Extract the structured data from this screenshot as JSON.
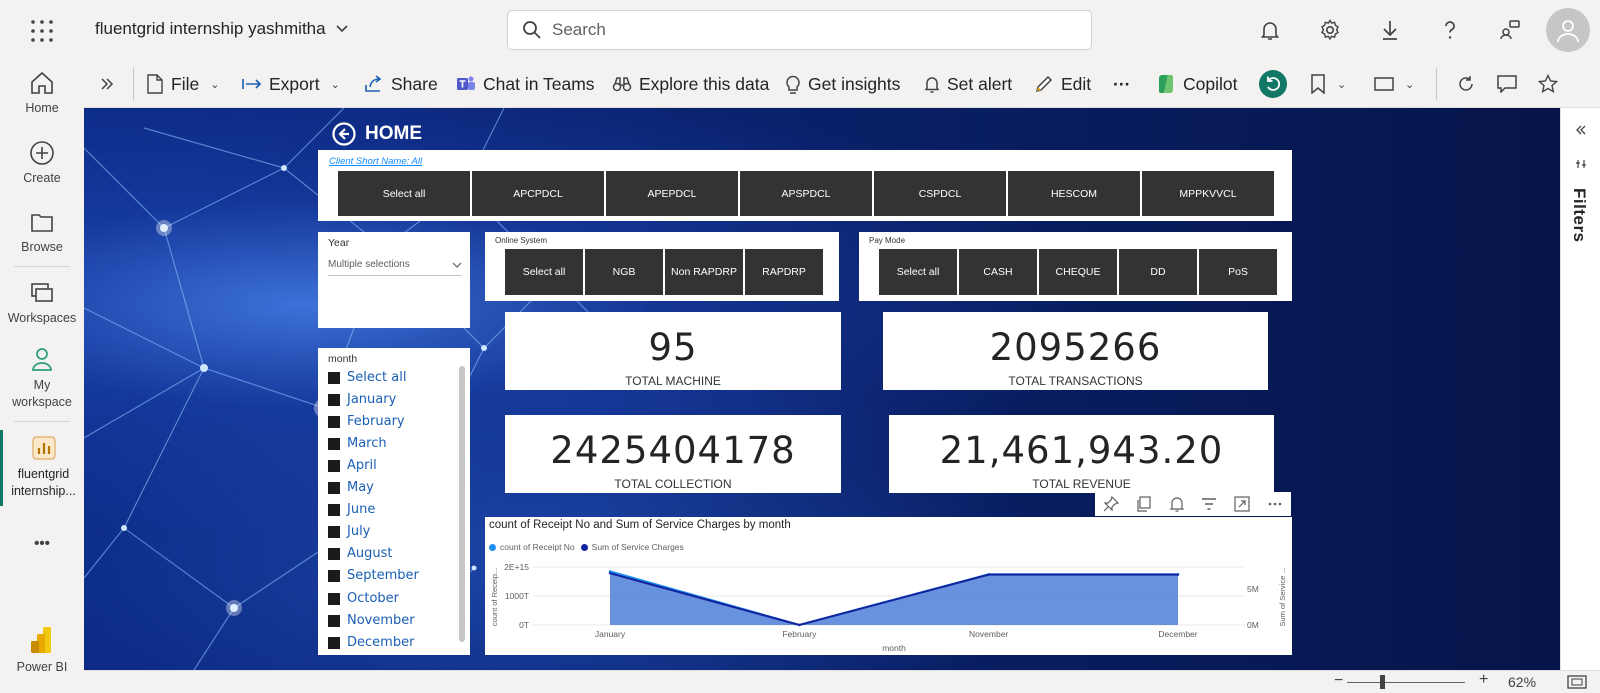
{
  "app": {
    "workspace_title": "fluentgrid internship yashmitha",
    "search_placeholder": "Search",
    "brand_label": "Power BI"
  },
  "left_nav": {
    "home": "Home",
    "create": "Create",
    "browse": "Browse",
    "workspaces": "Workspaces",
    "my_workspace": "My workspace",
    "report": "fluentgrid internship...",
    "more": "•••"
  },
  "ribbon": {
    "file": "File",
    "export": "Export",
    "share": "Share",
    "chat_in_teams": "Chat in Teams",
    "explore": "Explore this data",
    "insights": "Get insights",
    "set_alert": "Set alert",
    "edit": "Edit",
    "more": "···",
    "copilot": "Copilot"
  },
  "filters_pane": {
    "label": "Filters"
  },
  "status": {
    "zoom": "62%",
    "zoom_level": 0.62
  },
  "report": {
    "home_label": "HOME",
    "client_label": "Client Short Name: All",
    "clients": [
      "Select all",
      "APCPDCL",
      "APEPDCL",
      "APSPDCL",
      "CSPDCL",
      "HESCOM",
      "MPPKVVCL"
    ],
    "year": {
      "title": "Year",
      "value": "Multiple selections"
    },
    "online_system": {
      "title": "Online System",
      "options": [
        "Select all",
        "NGB",
        "Non RAPDRP",
        "RAPDRP"
      ]
    },
    "pay_mode": {
      "title": "Pay Mode",
      "options": [
        "Select all",
        "CASH",
        "CHEQUE",
        "DD",
        "PoS"
      ]
    },
    "month": {
      "title": "month",
      "options": [
        "Select all",
        "January",
        "February",
        "March",
        "April",
        "May",
        "June",
        "July",
        "August",
        "September",
        "October",
        "November",
        "December"
      ]
    },
    "kpis": {
      "total_machine": {
        "value": "95",
        "label": "TOTAL MACHINE"
      },
      "total_transactions": {
        "value": "2095266",
        "label": "TOTAL TRANSACTIONS"
      },
      "total_collection": {
        "value": "2425404178",
        "label": "TOTAL COLLECTION"
      },
      "total_revenue": {
        "value": "21,461,943.20",
        "label": "TOTAL REVENUE"
      }
    }
  },
  "chart_data": {
    "type": "area",
    "title": "count of Receipt No and Sum of Service Charges by month",
    "xlabel": "month",
    "ylabel": "count of Receip...",
    "y2label": "Sum of Service ...",
    "categories": [
      "January",
      "February",
      "November",
      "December"
    ],
    "y_ticks": [
      "2E+15",
      "1000T",
      "0T"
    ],
    "y2_ticks": [
      "5M",
      "0M"
    ],
    "ylim": [
      0,
      2000000000000000
    ],
    "y2lim": [
      0,
      8000000
    ],
    "legend_position": "top-left",
    "series": [
      {
        "name": "count of Receipt No",
        "axis": "left",
        "color": "#1f8ef1",
        "values": [
          1850000000000000,
          0,
          1750000000000000,
          1750000000000000
        ]
      },
      {
        "name": "Sum of Service Charges",
        "axis": "right",
        "color": "#12239e",
        "values": [
          7150000,
          0,
          6950000,
          6950000
        ]
      }
    ]
  }
}
